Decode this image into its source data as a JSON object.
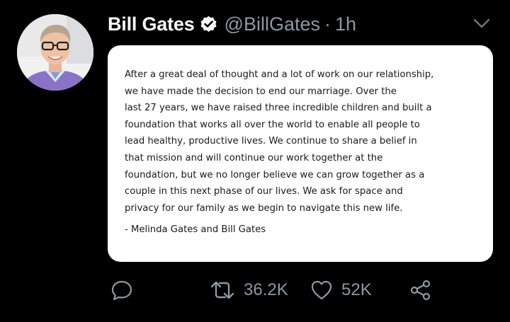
{
  "tweet": {
    "display_name": "Bill Gates",
    "handle": "@BillGates",
    "separator": "·",
    "time": "1h",
    "verified": true,
    "icons": {
      "verified": "verified-badge-icon",
      "more": "chevron-down-icon",
      "reply": "reply-icon",
      "retweet": "retweet-icon",
      "like": "heart-icon",
      "share": "share-icon"
    },
    "colors": {
      "background": "#000000",
      "secondary_text": "#8b98a5",
      "card": "#ffffff"
    }
  },
  "image_card": {
    "statement": "After a great deal of thought and a lot of work on our relationship,\nwe have made the decision to end our marriage. Over the\nlast 27 years, we have raised three incredible children and built a\nfoundation that works all over the world to enable all people to\nlead healthy, productive lives. We continue to share a belief in\nthat mission and will continue our work together at the\nfoundation, but we no longer believe we can grow together as a\ncouple in this next phase of our lives. We ask for space and\nprivacy for our family as we begin to navigate this new life.",
    "signature": "- Melinda Gates and Bill Gates"
  },
  "actions": {
    "retweet_count": "36.2K",
    "like_count": "52K"
  }
}
